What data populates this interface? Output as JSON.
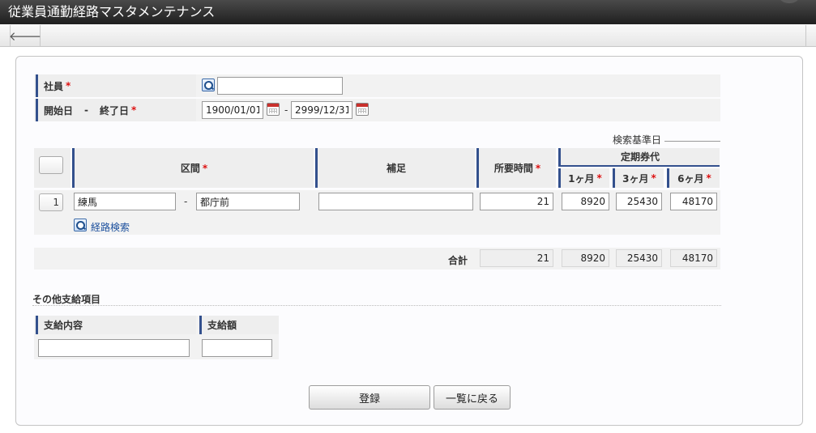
{
  "window": {
    "title": "従業員通勤経路マスタメンテナンス"
  },
  "toolbar": {
    "back_icon": "arrow-left-icon",
    "back_glyph": "🡐"
  },
  "form": {
    "employee": {
      "label": "社員",
      "required_mark": "*",
      "value": ""
    },
    "period": {
      "label_start": "開始日",
      "separator": "-",
      "label_end": "終了日",
      "required_mark": "*",
      "start_value": "1900/01/01",
      "end_value": "2999/12/31",
      "range_separator": "-"
    },
    "search_date_label": "検索基準日"
  },
  "route_table": {
    "headers": {
      "section": "区間",
      "note": "補足",
      "time": "所要時間",
      "commuter_pass": "定期券代",
      "m1": "1ヶ月",
      "m3": "3ヶ月",
      "m6": "6ヶ月",
      "required_mark": "*"
    },
    "rows": [
      {
        "no": "1",
        "from": "練馬",
        "separator": "-",
        "to": "都庁前",
        "note": "",
        "time": "21",
        "m1": "8920",
        "m3": "25430",
        "m6": "48170"
      }
    ],
    "route_search_label": "経路検索",
    "total": {
      "label": "合計",
      "time": "21",
      "m1": "8920",
      "m3": "25430",
      "m6": "48170"
    }
  },
  "other": {
    "title": "その他支給項目",
    "col_content": "支給内容",
    "col_amount": "支給額",
    "content_value": "",
    "amount_value": ""
  },
  "buttons": {
    "register": "登録",
    "back_to_list": "一覧に戻る"
  },
  "colors": {
    "title_bar": "#2b2b2b",
    "accent": "#33508d",
    "required": "#dd1111",
    "link": "#1a4e9c"
  }
}
